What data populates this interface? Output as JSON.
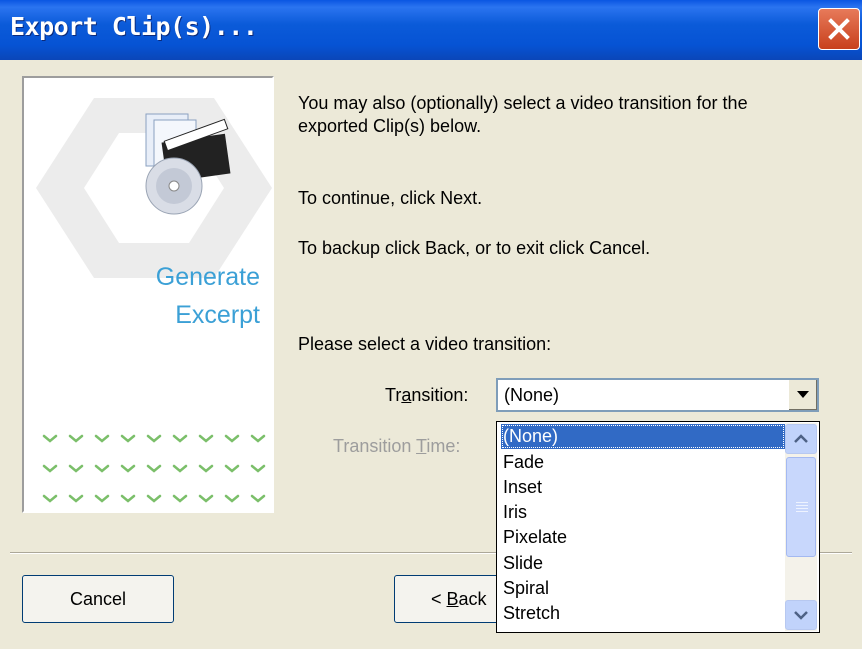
{
  "window": {
    "title": "Export Clip(s)...",
    "close_icon": "close-icon"
  },
  "side": {
    "heading_line1": "Generate",
    "heading_line2": "Excerpt"
  },
  "instructions": {
    "line1": "You may also (optionally) select a video transition for the",
    "line2": "exported Clip(s) below.",
    "line3": "To continue, click Next.",
    "line4": "To backup click Back, or to exit click Cancel.",
    "prompt": "Please select a video transition:"
  },
  "form": {
    "transition_label_pre": "Tr",
    "transition_label_key": "a",
    "transition_label_post": "nsition:",
    "transition_value": "(None)",
    "time_label_pre": "Transition ",
    "time_label_key": "T",
    "time_label_post": "ime:"
  },
  "dropdown": {
    "options": [
      "(None)",
      "Fade",
      "Inset",
      "Iris",
      "Pixelate",
      "Slide",
      "Spiral",
      "Stretch"
    ],
    "selected_index": 0
  },
  "buttons": {
    "cancel": "Cancel",
    "back_prefix": "< ",
    "back_key": "B",
    "back_rest": "ack"
  },
  "colors": {
    "accent": "#3ba0d6",
    "selection": "#316ac5",
    "titlebar": "#0653d4"
  }
}
